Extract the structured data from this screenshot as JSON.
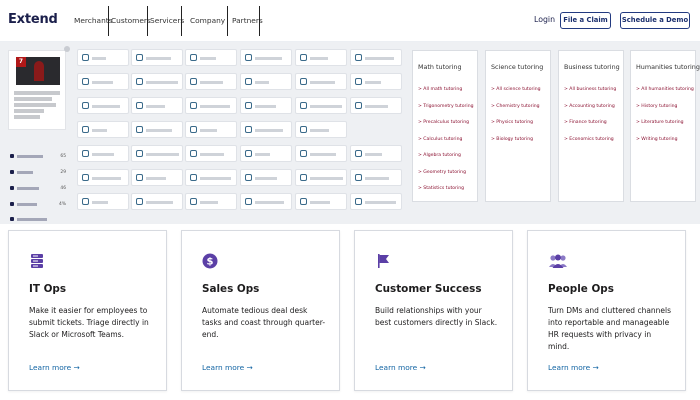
{
  "header": {
    "logo": "Extend",
    "nav": [
      "Merchants",
      "Customers",
      "Servicers",
      "Company",
      "Partners"
    ],
    "login": "Login",
    "file_claim": "File a Claim",
    "schedule_demo": "Schedule a Demo"
  },
  "collage": {
    "book_badge": "7",
    "sidebar_items": [
      {
        "label": "",
        "count": "65"
      },
      {
        "label": "",
        "count": "29"
      },
      {
        "label": "",
        "count": "46"
      },
      {
        "label": "",
        "count": "4%"
      }
    ],
    "subjects": [
      {
        "heading": "Math tutoring",
        "items": [
          "All math tutoring",
          "Trigonometry tutoring",
          "Precalculus tutoring",
          "Calculus tutoring",
          "Algebra tutoring",
          "Geometry tutoring",
          "Statistics tutoring"
        ]
      },
      {
        "heading": "Science tutoring",
        "items": [
          "All science tutoring",
          "Chemistry tutoring",
          "Physics tutoring",
          "Biology tutoring"
        ]
      },
      {
        "heading": "Business tutoring",
        "items": [
          "All business tutoring",
          "Accounting tutoring",
          "Finance tutoring",
          "Economics tutoring"
        ]
      },
      {
        "heading": "Humanities tutoring",
        "items": [
          "All humanities tutoring",
          "History tutoring",
          "Literature tutoring",
          "Writing tutoring"
        ]
      }
    ]
  },
  "cards": [
    {
      "title": "IT Ops",
      "desc": "Make it easier for employees to submit tickets. Triage directly in Slack or Microsoft Teams.",
      "link": "Learn more →",
      "icon": "server-icon"
    },
    {
      "title": "Sales Ops",
      "desc": "Automate tedious deal desk tasks and coast through quarter-end.",
      "link": "Learn more →",
      "icon": "dollar-icon"
    },
    {
      "title": "Customer Success",
      "desc": "Build relationships with your best customers directly in Slack.",
      "link": "Learn more →",
      "icon": "flag-icon"
    },
    {
      "title": "People Ops",
      "desc": "Turn DMs and cluttered channels into reportable and manageable HR requests with privacy in mind.",
      "link": "Learn more →",
      "icon": "people-icon"
    }
  ],
  "colors": {
    "accent": "#5b3fa6",
    "link": "#1264a3",
    "brand": "#1b1f4b",
    "subject_link": "#8a1030"
  }
}
